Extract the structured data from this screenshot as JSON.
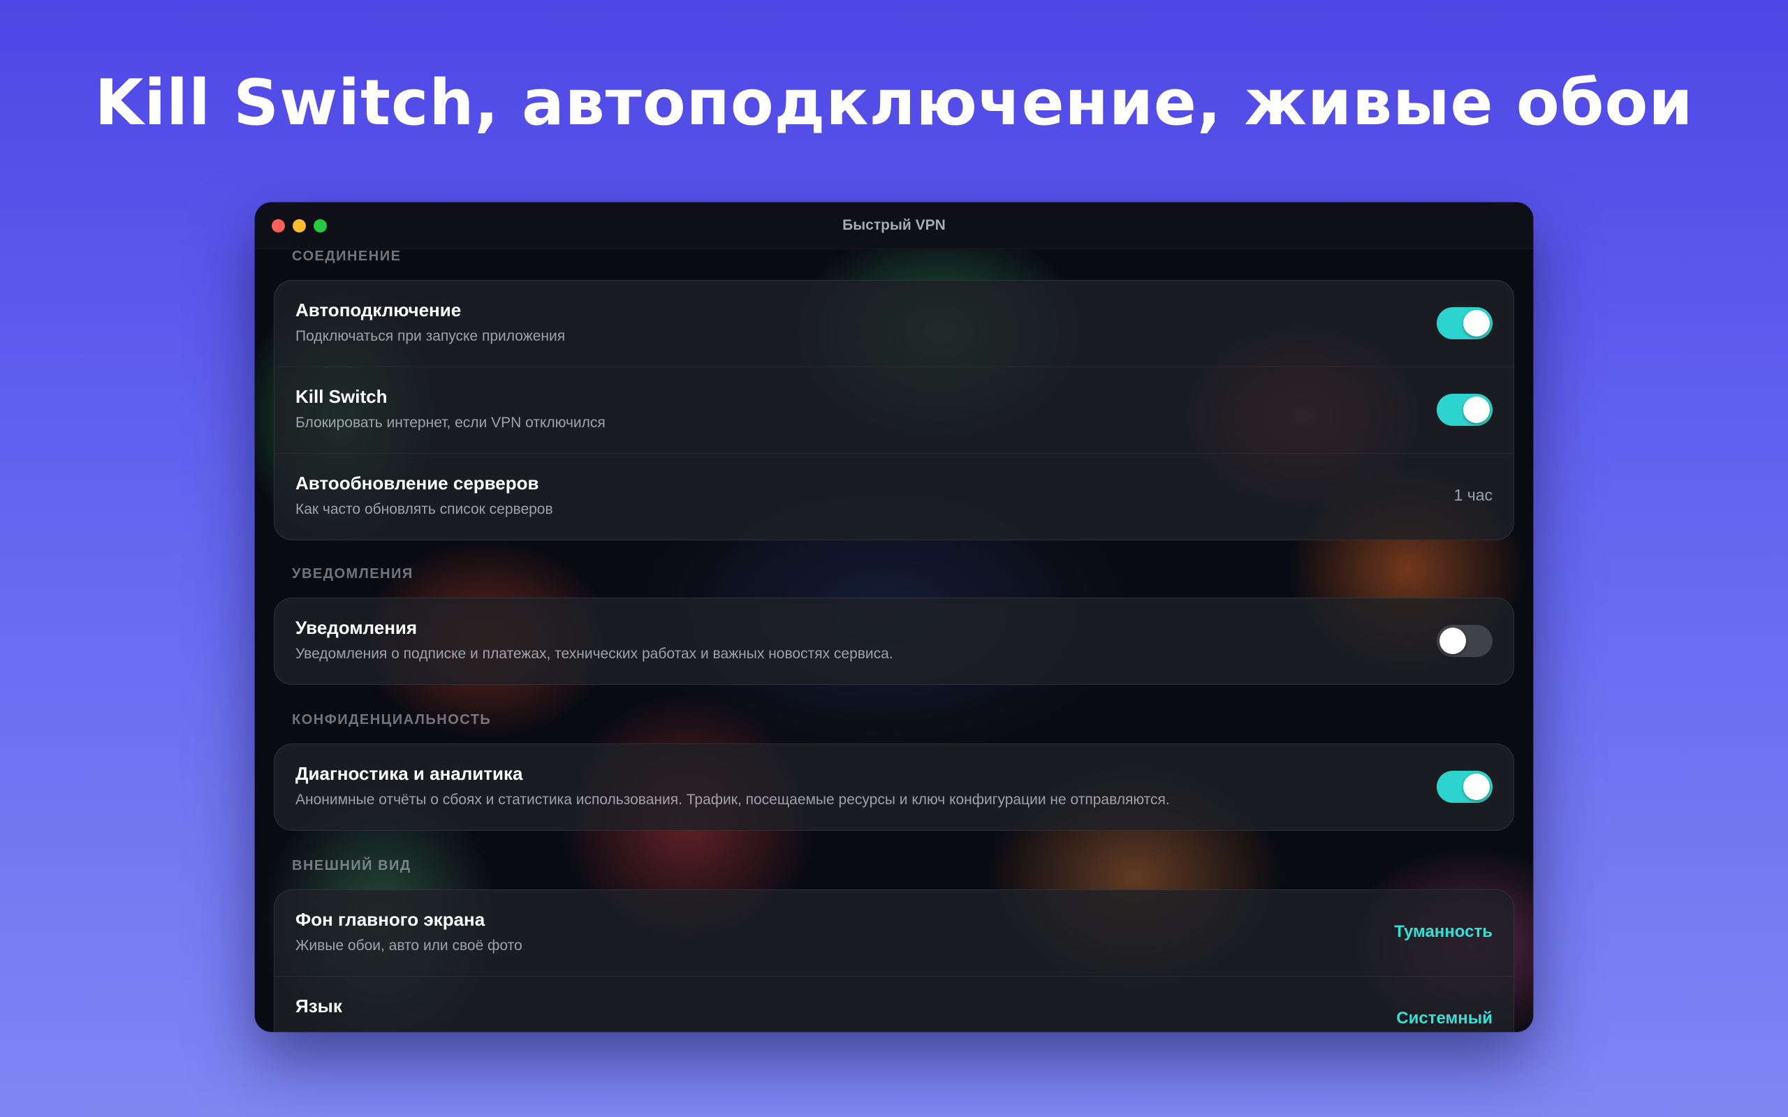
{
  "headline": "Kill Switch, автоподключение, живые обои",
  "window": {
    "title": "Быстрый VPN"
  },
  "sections": {
    "connection": {
      "label": "СОЕДИНЕНИЕ",
      "autoconnect": {
        "title": "Автоподключение",
        "subtitle": "Подключаться при запуске приложения",
        "enabled": true
      },
      "killswitch": {
        "title": "Kill Switch",
        "subtitle": "Блокировать интернет, если VPN отключился",
        "enabled": true
      },
      "server_update": {
        "title": "Автообновление серверов",
        "subtitle": "Как часто обновлять список серверов",
        "value": "1 час"
      }
    },
    "notifications": {
      "label": "УВЕДОМЛЕНИЯ",
      "notifications": {
        "title": "Уведомления",
        "subtitle": "Уведомления о подписке и платежах, технических работах и важных новостях сервиса.",
        "enabled": false
      }
    },
    "privacy": {
      "label": "КОНФИДЕНЦИАЛЬНОСТЬ",
      "diagnostics": {
        "title": "Диагностика и аналитика",
        "subtitle": "Анонимные отчёты о сбоях и статистика использования. Трафик, посещаемые ресурсы и ключ конфигурации не отправляются.",
        "enabled": true
      }
    },
    "appearance": {
      "label": "ВНЕШНИЙ ВИД",
      "background": {
        "title": "Фон главного экрана",
        "subtitle": "Живые обои, авто или своё фото",
        "value": "Туманность"
      },
      "language": {
        "title": "Язык",
        "value": "Системный"
      }
    }
  },
  "colors": {
    "accent": "#2dd4cf",
    "accent_text": "#35dfd6",
    "page_gradient_top": "#4f46e5",
    "page_gradient_bottom": "#7f87f3"
  }
}
